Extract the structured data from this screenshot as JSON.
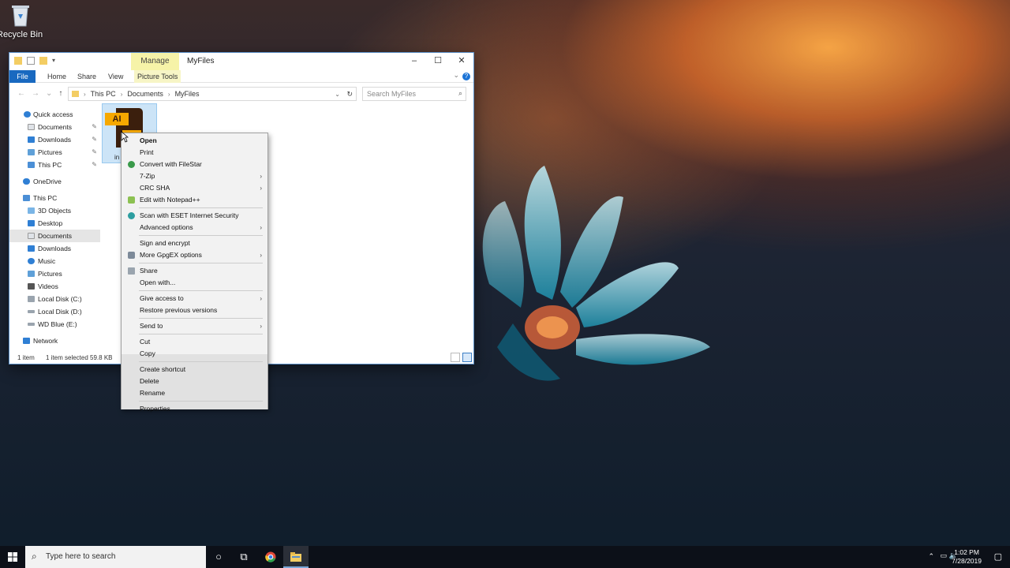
{
  "desktop": {
    "recycle_bin_label": "Recycle Bin"
  },
  "window": {
    "title": "MyFiles",
    "manage_tab": "Manage",
    "ribbon_tabs": [
      "File",
      "Home",
      "Share",
      "View",
      "Picture Tools"
    ],
    "breadcrumb": [
      "This PC",
      "Documents",
      "MyFiles"
    ],
    "search_placeholder": "Search MyFiles",
    "nav": {
      "quick_access": "Quick access",
      "quick_items": [
        "Documents",
        "Downloads",
        "Pictures",
        "This PC"
      ],
      "onedrive": "OneDrive",
      "this_pc": "This PC",
      "pc_items": [
        "3D Objects",
        "Desktop",
        "Documents",
        "Downloads",
        "Music",
        "Pictures",
        "Videos",
        "Local Disk (C:)",
        "Local Disk (D:)",
        "WD Blue (E:)"
      ],
      "network": "Network"
    },
    "file": {
      "badge": "AI",
      "name": "in"
    },
    "status": {
      "count": "1 item",
      "selected": "1 item selected  59.8 KB"
    }
  },
  "context_menu": {
    "open": "Open",
    "print": "Print",
    "convert": "Convert with FileStar",
    "zip": "7-Zip",
    "crc": "CRC SHA",
    "notepad": "Edit with Notepad++",
    "eset": "Scan with ESET Internet Security",
    "advanced": "Advanced options",
    "sign": "Sign and encrypt",
    "gpg": "More GpgEX options",
    "share": "Share",
    "open_with": "Open with...",
    "give_access": "Give access to",
    "restore": "Restore previous versions",
    "send_to": "Send to",
    "cut": "Cut",
    "copy": "Copy",
    "create_shortcut": "Create shortcut",
    "delete": "Delete",
    "rename": "Rename",
    "properties": "Properties"
  },
  "taskbar": {
    "search_placeholder": "Type here to search",
    "time": "1:02 PM",
    "date": "7/28/2019"
  },
  "colors": {
    "accent": "#1969c0",
    "selection": "#cce4f7",
    "manage": "#f6f3a8"
  }
}
